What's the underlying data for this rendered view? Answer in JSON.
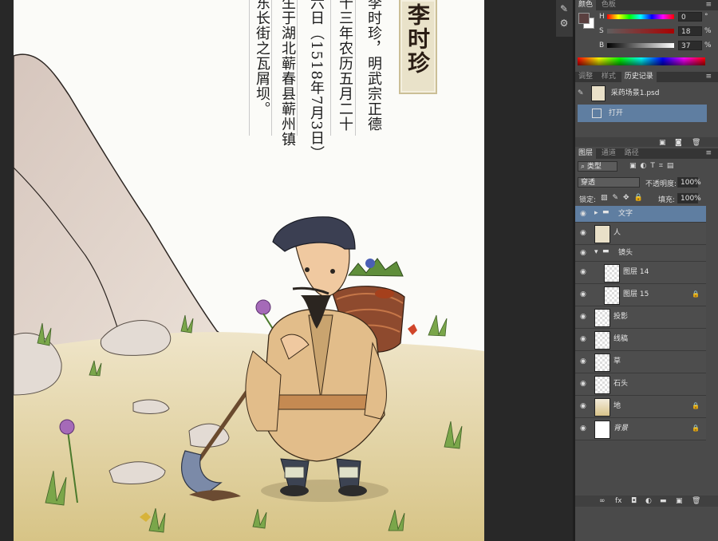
{
  "canvas": {
    "text_lines": [
      "李时珍，明武宗正德",
      "十三年农历五月二十",
      "六日（1518年7月3日）",
      "生于湖北蕲春县蕲州镇",
      "东长街之瓦屑坝。"
    ],
    "seal_title": "李时珍"
  },
  "toolbar": {
    "icons": [
      "brush-preset-icon",
      "tool-preset-icon"
    ]
  },
  "color_panel": {
    "tabs": [
      "颜色",
      "色板"
    ],
    "active_tab": "颜色",
    "foreground": "#5a4040",
    "background": "#ffffff",
    "sliders": [
      {
        "label": "H",
        "value": "0",
        "unit": "°",
        "level": 0
      },
      {
        "label": "S",
        "value": "18",
        "unit": "%",
        "level": 0.18
      },
      {
        "label": "B",
        "value": "37",
        "unit": "%",
        "level": 0.37
      }
    ]
  },
  "history_panel": {
    "tabs": [
      "调整",
      "样式",
      "历史记录"
    ],
    "active_tab": "历史记录",
    "snapshot": "采药场景1.psd",
    "states": [
      "打开"
    ]
  },
  "layers_panel": {
    "tabs": [
      "图层",
      "通道",
      "路径"
    ],
    "active_tab": "图层",
    "filter_label": "类型",
    "blend_mode": "穿透",
    "opacity_label": "不透明度:",
    "opacity": "100%",
    "lock_label": "锁定:",
    "fill_label": "填充:",
    "fill": "100%",
    "layers": [
      {
        "name": "文字",
        "type": "group",
        "selected": true,
        "locked": false
      },
      {
        "name": "人",
        "type": "layer",
        "selected": false,
        "locked": false
      },
      {
        "name": "镜头",
        "type": "group-open",
        "selected": false,
        "locked": false
      },
      {
        "name": "图层 14",
        "type": "sublayer",
        "selected": false,
        "locked": false
      },
      {
        "name": "图层 15",
        "type": "sublayer",
        "selected": false,
        "locked": true
      },
      {
        "name": "投影",
        "type": "layer",
        "selected": false,
        "locked": false
      },
      {
        "name": "线稿",
        "type": "layer",
        "selected": false,
        "locked": false
      },
      {
        "name": "草",
        "type": "layer",
        "selected": false,
        "locked": false
      },
      {
        "name": "石头",
        "type": "layer",
        "selected": false,
        "locked": false
      },
      {
        "name": "地",
        "type": "layer",
        "selected": false,
        "locked": true
      },
      {
        "name": "背景",
        "type": "layer",
        "selected": false,
        "locked": true
      }
    ]
  }
}
